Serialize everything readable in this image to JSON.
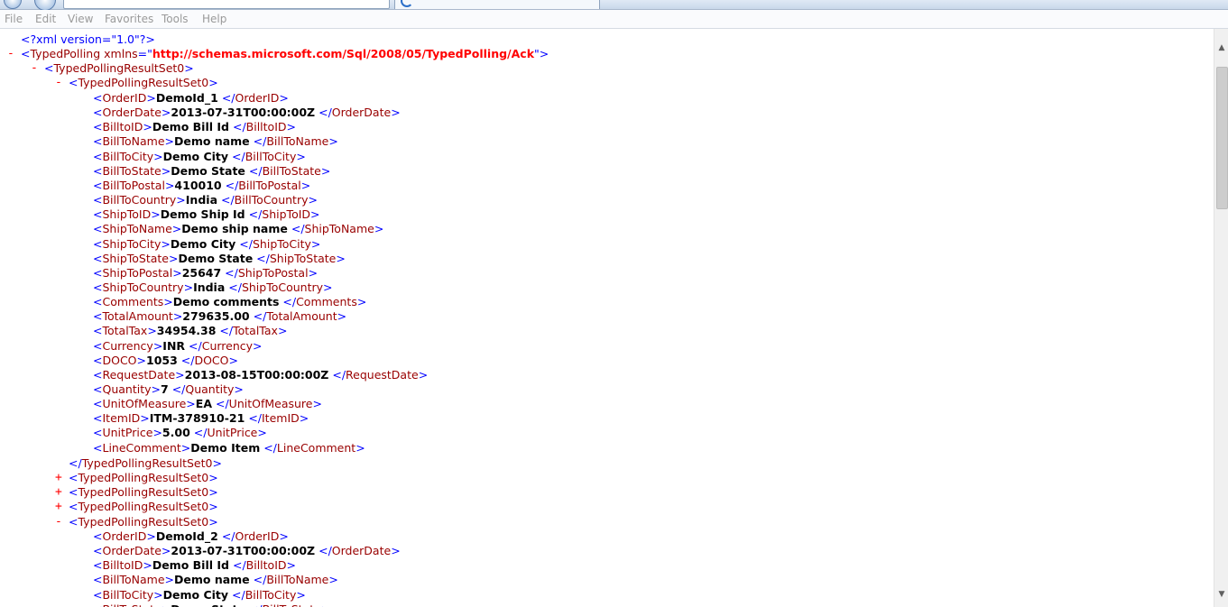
{
  "menubar": {
    "items": [
      "File",
      "Edit",
      "View",
      "Favorites",
      "Tools",
      "Help"
    ]
  },
  "colors": {
    "bracket": "#0000ff",
    "tag": "#990000",
    "attribute_value": "#ff0000",
    "text_value": "#000000",
    "expand_collapse": "#ff0000"
  },
  "xml": {
    "declaration": "<?xml version=\"1.0\"?>",
    "root_tag": "TypedPolling",
    "root_attr_name": "xmlns",
    "root_attr_value": "http://schemas.microsoft.com/Sql/2008/05/TypedPolling/Ack",
    "result_set_tag": "TypedPollingResultSet0",
    "record1": [
      {
        "tag": "OrderID",
        "value": "DemoId_1"
      },
      {
        "tag": "OrderDate",
        "value": "2013-07-31T00:00:00Z"
      },
      {
        "tag": "BilltoID",
        "value": "Demo Bill Id"
      },
      {
        "tag": "BillToName",
        "value": "Demo name"
      },
      {
        "tag": "BillToCity",
        "value": "Demo City"
      },
      {
        "tag": "BillToState",
        "value": "Demo State"
      },
      {
        "tag": "BillToPostal",
        "value": "410010"
      },
      {
        "tag": "BillToCountry",
        "value": "India"
      },
      {
        "tag": "ShipToID",
        "value": "Demo Ship Id"
      },
      {
        "tag": "ShipToName",
        "value": "Demo ship name"
      },
      {
        "tag": "ShipToCity",
        "value": "Demo City"
      },
      {
        "tag": "ShipToState",
        "value": "Demo State"
      },
      {
        "tag": "ShipToPostal",
        "value": "25647"
      },
      {
        "tag": "ShipToCountry",
        "value": "India"
      },
      {
        "tag": "Comments",
        "value": "Demo comments"
      },
      {
        "tag": "TotalAmount",
        "value": "279635.00"
      },
      {
        "tag": "TotalTax",
        "value": "34954.38"
      },
      {
        "tag": "Currency",
        "value": "INR"
      },
      {
        "tag": "DOCO",
        "value": "1053"
      },
      {
        "tag": "RequestDate",
        "value": "2013-08-15T00:00:00Z"
      },
      {
        "tag": "Quantity",
        "value": "7"
      },
      {
        "tag": "UnitOfMeasure",
        "value": "EA"
      },
      {
        "tag": "ItemID",
        "value": "ITM-378910-21"
      },
      {
        "tag": "UnitPrice",
        "value": "5.00"
      },
      {
        "tag": "LineComment",
        "value": "Demo Item"
      }
    ],
    "collapsed_count": 3,
    "record2": [
      {
        "tag": "OrderID",
        "value": "DemoId_2"
      },
      {
        "tag": "OrderDate",
        "value": "2013-07-31T00:00:00Z"
      },
      {
        "tag": "BilltoID",
        "value": "Demo Bill Id"
      },
      {
        "tag": "BillToName",
        "value": "Demo name"
      },
      {
        "tag": "BillToCity",
        "value": "Demo City"
      },
      {
        "tag": "BillToState",
        "value": "Demo State"
      }
    ],
    "expand_symbol": "+",
    "collapse_symbol": "-"
  }
}
